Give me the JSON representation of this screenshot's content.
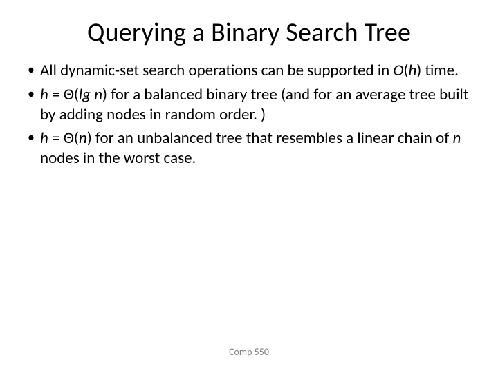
{
  "title": "Querying a Binary Search Tree",
  "bullets": {
    "b1": {
      "pre": "All dynamic-set search operations can be supported in ",
      "oh": "O",
      "paren_open": "(",
      "h": "h",
      "paren_close": ")",
      "post": " time."
    },
    "b2": {
      "h": "h",
      "eq": " = ",
      "theta": "Θ(",
      "lg": "lg n",
      "close": ")",
      "post": " for a balanced binary tree (and for an average tree built by adding nodes in random order. )"
    },
    "b3": {
      "h": "h",
      "eq": " = ",
      "theta": "Θ(",
      "n": "n",
      "close": ")",
      "post1": " for an unbalanced tree that resembles a linear chain of ",
      "n2": "n",
      "post2": " nodes in the worst case."
    }
  },
  "footer": "Comp 550"
}
